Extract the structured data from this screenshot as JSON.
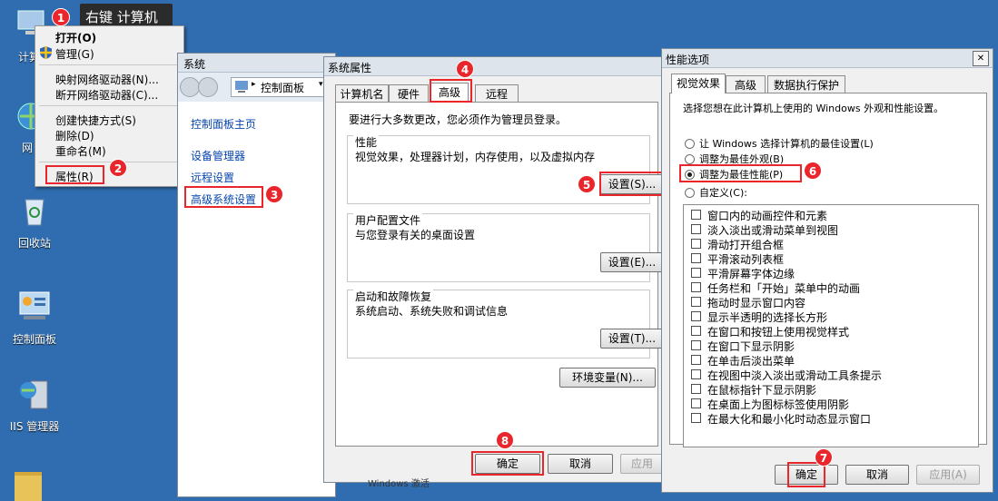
{
  "desktop": {
    "icons": [
      {
        "name": "计算机"
      },
      {
        "name": "网"
      },
      {
        "name": "回收站"
      },
      {
        "name": "控制面板"
      },
      {
        "name": "IIS 管理器"
      }
    ]
  },
  "tooltip": "右键 计算机",
  "context_menu": {
    "items": [
      "打开(O)",
      "管理(G)",
      "映射网络驱动器(N)...",
      "断开网络驱动器(C)...",
      "创建快捷方式(S)",
      "删除(D)",
      "重命名(M)",
      "属性(R)"
    ]
  },
  "system_window": {
    "title": "系统",
    "address": "控制面板",
    "links": [
      "控制面板主页",
      "设备管理器",
      "远程设置",
      "高级系统设置"
    ],
    "footer_text": "Windows 激活"
  },
  "sys_props": {
    "title": "系统属性",
    "tabs": [
      "计算机名",
      "硬件",
      "高级",
      "远程"
    ],
    "admin_note": "要进行大多数更改，您必须作为管理员登录。",
    "performance": {
      "title": "性能",
      "desc": "视觉效果，处理器计划，内存使用，以及虚拟内存",
      "button": "设置(S)..."
    },
    "profiles": {
      "title": "用户配置文件",
      "desc": "与您登录有关的桌面设置",
      "button": "设置(E)..."
    },
    "startup": {
      "title": "启动和故障恢复",
      "desc": "系统启动、系统失败和调试信息",
      "button": "设置(T)..."
    },
    "env_button": "环境变量(N)...",
    "ok": "确定",
    "cancel": "取消",
    "apply": "应用"
  },
  "perf_options": {
    "title": "性能选项",
    "close": "✕",
    "tabs": [
      "视觉效果",
      "高级",
      "数据执行保护"
    ],
    "prompt": "选择您想在此计算机上使用的 Windows 外观和性能设置。",
    "radios": [
      "让 Windows 选择计算机的最佳设置(L)",
      "调整为最佳外观(B)",
      "调整为最佳性能(P)",
      "自定义(C):"
    ],
    "checkboxes": [
      "窗口内的动画控件和元素",
      "淡入淡出或滑动菜单到视图",
      "滑动打开组合框",
      "平滑滚动列表框",
      "平滑屏幕字体边缘",
      "任务栏和「开始」菜单中的动画",
      "拖动时显示窗口内容",
      "显示半透明的选择长方形",
      "在窗口和按钮上使用视觉样式",
      "在窗口下显示阴影",
      "在单击后淡出菜单",
      "在视图中淡入淡出或滑动工具条提示",
      "在鼠标指针下显示阴影",
      "在桌面上为图标标签使用阴影",
      "在最大化和最小化时动态显示窗口"
    ],
    "ok": "确定",
    "cancel": "取消",
    "apply": "应用(A)"
  },
  "steps": [
    "1",
    "2",
    "3",
    "4",
    "5",
    "6",
    "7",
    "8"
  ],
  "colors": {
    "desktop": "#2f6db0",
    "marker": "#e8262b",
    "link": "#0645ad"
  }
}
